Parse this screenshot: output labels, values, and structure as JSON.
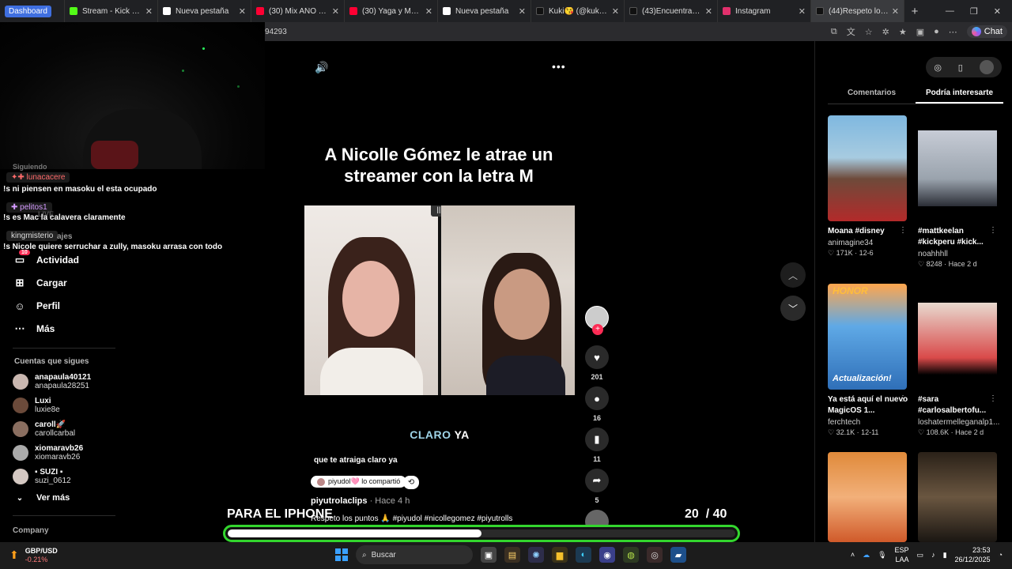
{
  "browser": {
    "tabs": [
      {
        "label": "Dashboard",
        "type": "pill"
      },
      {
        "label": "Stream - Kick Dashboa",
        "favcolor": "#53fc18"
      },
      {
        "label": "Nueva pestaña",
        "favcolor": "#ffffff"
      },
      {
        "label": "(30) Mix AÑO NU",
        "favcolor": "#ff0033"
      },
      {
        "label": "(30) Yaga y Mackie fea",
        "favcolor": "#ff0033"
      },
      {
        "label": "Nueva pestaña",
        "favcolor": "#ffffff"
      },
      {
        "label": "Kuki😘 (@kuki_miau)",
        "favcolor": "#111111"
      },
      {
        "label": "(43)Encuentra 'CUMPL",
        "favcolor": "#111111"
      },
      {
        "label": "Instagram",
        "favcolor": "#e1306c"
      },
      {
        "label": "(44)Respeto los p",
        "favcolor": "#111111"
      }
    ],
    "new_tab": "+",
    "url": "94293",
    "chat_label": "Chat"
  },
  "chat_overlay": {
    "cut_top": "Siguiendo",
    "messages": [
      {
        "user": "lunacacere",
        "text": "!s ni piensen en masoku el esta ocupado"
      },
      {
        "user": "pelitos1",
        "text": "!s es Mac la calavera claramente"
      },
      {
        "user": "kingmisterio",
        "text": "!s Nicole quiere serruchar a zully, masoku arrasa con todo"
      }
    ],
    "ghost_live": "LIVE",
    "ghost_msgs": "ajes",
    "notif_count": "10"
  },
  "sidebar": {
    "nav": [
      {
        "label": "Actividad",
        "icon": "activity-icon"
      },
      {
        "label": "Cargar",
        "icon": "upload-icon"
      },
      {
        "label": "Perfil",
        "icon": "profile-icon"
      },
      {
        "label": "Más",
        "icon": "more-icon"
      }
    ],
    "following_title": "Cuentas que sigues",
    "accounts": [
      {
        "name": "anapaula40121",
        "handle": "anapaula28251"
      },
      {
        "name": "Luxi",
        "handle": "luxie8e"
      },
      {
        "name": "caroll🚀",
        "handle": "carollcarbal"
      },
      {
        "name": "xiomaravb26",
        "handle": "xiomaravb26"
      },
      {
        "name": "▪ SUZI ▪",
        "handle": "suzi_0612"
      }
    ],
    "see_more": "Ver más",
    "company": "Company"
  },
  "video": {
    "title": "A Nicolle Gómez le atrae un streamer con la letra M",
    "subtitle_highlight": "CLARO",
    "subtitle_rest": " YA",
    "caption": "que te atraiga claro ya",
    "shared_by": "piyudol🩷 lo compartió",
    "author": "piyutrolaclips",
    "ago": " · Hace 4 h",
    "description": "Respeto los puntos 🙏 #piyudol #nicollegomez #piyutrolls",
    "likes": "201",
    "comments": "16",
    "saves": "11",
    "shares": "5"
  },
  "rightpanel": {
    "tab_comments": "Comentarios",
    "tab_suggested": "Podría interesarte",
    "cards": [
      {
        "title": "Moana #disney",
        "user": "animagine34",
        "stats": "♡ 171K · 12-6"
      },
      {
        "title": "#mattkeelan #kickperu #kick...",
        "user": "noahhhll",
        "stats": "♡ 8248 · Hace 2 d"
      },
      {
        "title": "Ya está aquí el nuevo MagicOS 1...",
        "user": "ferchtech",
        "stats": "♡ 32.1K · 12-11",
        "overlay_top": "HONOR",
        "overlay_bottom": "Actualización!"
      },
      {
        "title": "#sara #carlosalbertofu...",
        "user": "loshatermelleganalp1...",
        "stats": "♡ 108.6K · Hace 2 d"
      },
      {
        "title": "",
        "user": "",
        "stats": ""
      },
      {
        "title": "",
        "user": "",
        "stats": ""
      }
    ]
  },
  "overlay": {
    "label": "PARA EL IPHONE",
    "count_current": "20",
    "count_total": "/ 40",
    "progress_fraction": 0.5,
    "accent": "#33d62e"
  },
  "taskbar": {
    "ticker_pair": "GBP/USD",
    "ticker_change": "-0.21%",
    "search_label": "Buscar",
    "lang": "ESP",
    "lang2": "LAA",
    "time": "23:53",
    "date": "26/12/2025"
  }
}
